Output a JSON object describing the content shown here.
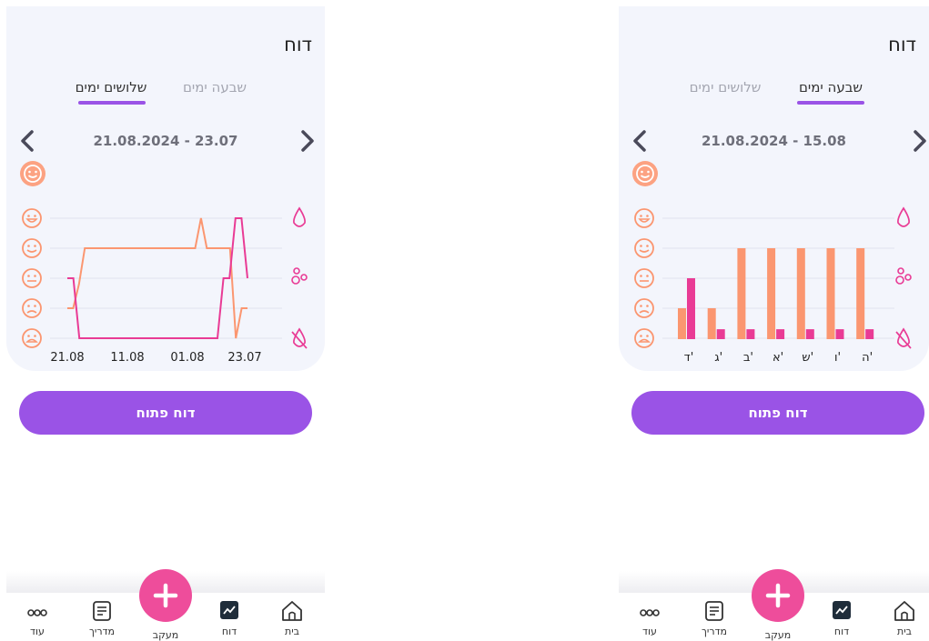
{
  "screens": [
    {
      "title": "דוח",
      "tabs": [
        {
          "label": "שלושים ימים",
          "active": true
        },
        {
          "label": "שבעה ימים",
          "active": false
        }
      ],
      "date_range": "21.08.2024 - 23.07",
      "open_report_button": "דוח פתוח",
      "chart_data": {
        "type": "line",
        "x_labels": [
          "21.08",
          "11.08",
          "01.08",
          "23.07"
        ],
        "y_scale": [
          "very happy",
          "happy",
          "neutral",
          "sad",
          "very sad"
        ],
        "series": [
          {
            "color": "#fb9670",
            "values": [
              2,
              2,
              2.8,
              4,
              4,
              4,
              4,
              4,
              4,
              4,
              4,
              4,
              4,
              4,
              4,
              4,
              4,
              4,
              4,
              4,
              4,
              4,
              4,
              5,
              4,
              4,
              4,
              4,
              4,
              1,
              2,
              2
            ]
          },
          {
            "color": "#e93b95",
            "values": [
              3,
              3,
              1,
              1,
              1,
              1,
              1,
              1,
              1,
              1,
              1,
              1,
              1,
              1,
              1,
              1,
              1,
              1,
              1,
              1,
              1,
              1,
              1,
              1,
              1,
              1,
              3,
              3,
              5,
              5,
              3
            ]
          }
        ]
      }
    },
    {
      "title": "דוח",
      "tabs": [
        {
          "label": "שבעה ימים",
          "active": true
        },
        {
          "label": "שלושים ימים",
          "active": false
        }
      ],
      "date_range": "21.08.2024 - 15.08",
      "open_report_button": "דוח פתוח",
      "chart_data": {
        "type": "bar",
        "categories": [
          "ד'",
          "ג'",
          "ב'",
          "א'",
          "ש'",
          "ו'",
          "ה'"
        ],
        "series": [
          {
            "color": "#fb9670",
            "values": [
              2,
              2,
              4,
              4,
              4,
              4,
              4
            ]
          },
          {
            "color": "#e93b95",
            "values": [
              3,
              1.3,
              1.3,
              1.3,
              1.3,
              1.3,
              1.3
            ]
          }
        ]
      }
    }
  ],
  "nav": {
    "items": [
      {
        "label": "עוד",
        "icon": "more-icon"
      },
      {
        "label": "מדריך",
        "icon": "guide-icon"
      },
      {
        "label": "מעקב",
        "icon": "plus-icon"
      },
      {
        "label": "דוח",
        "icon": "chart-icon"
      },
      {
        "label": "בית",
        "icon": "home-icon"
      }
    ]
  },
  "colors": {
    "accent": "#9a53e6",
    "fab": "#ee4d9b",
    "mood_orange": "#fb9670",
    "drop_pink": "#e93b95",
    "card_bg": "#f3f5fc"
  }
}
